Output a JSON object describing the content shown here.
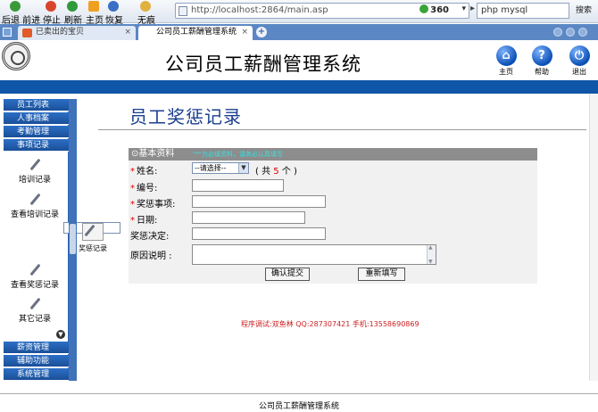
{
  "browser": {
    "nav_buttons": [
      {
        "label": "后退 前进",
        "color": "#3a9a3a"
      },
      {
        "label": "停止",
        "color": "#d9452b"
      },
      {
        "label": "刷新",
        "color": "#2f9a3a"
      },
      {
        "label": "主页",
        "color": "#f0a020"
      },
      {
        "label": "恢复",
        "color": "#3b6fc4"
      },
      {
        "label": "无痕",
        "color": "#e0b040"
      }
    ],
    "url": "http://localhost:2864/main.asp",
    "security_badge": "360",
    "search_query": "php mysql",
    "search_button": "搜索",
    "tabs": [
      {
        "label": "已卖出的宝贝",
        "icon": "taobao-icon"
      },
      {
        "label": "公司员工薪酬管理系统",
        "icon": "page-icon"
      }
    ],
    "tab_close": "×",
    "new_tab": "+"
  },
  "header": {
    "system_title": "公司员工薪酬管理系统",
    "icons": [
      {
        "label": "主页",
        "glyph": "⌂",
        "name": "home-icon"
      },
      {
        "label": "帮助",
        "glyph": "?",
        "name": "help-icon"
      },
      {
        "label": "退出",
        "glyph": "⏻",
        "name": "logout-icon"
      }
    ]
  },
  "sidebar": {
    "top_menus": [
      "员工列表",
      "人事档案",
      "考勤管理",
      "事项记录"
    ],
    "sub_items": [
      "培训记录",
      "查看培训记录",
      "奖惩记录",
      "查看奖惩记录",
      "其它记录"
    ],
    "bottom_menus": [
      "薪资管理",
      "辅助功能",
      "系统管理"
    ]
  },
  "main": {
    "page_title": "员工奖惩记录",
    "section_title": "⊙基本资料",
    "section_note": "\"*\"为必填资料，请务必认真填写",
    "fields": {
      "name_label": "姓名:",
      "name_select_value": "--请选择--",
      "count_prefix": "( 共",
      "count_value": "5",
      "count_suffix": "个 )",
      "id_label": "编号:",
      "item_label": "奖惩事项:",
      "date_label": "日期:",
      "decision_label": "奖惩决定:",
      "reason_label": "原因说明 :"
    },
    "required_mark": "*",
    "submit_button": "确认提交",
    "reset_button": "重新填写",
    "credits": "程序调试:双鱼林 QQ:287307421 手机:13558690869"
  },
  "footer": {
    "text": "公司员工薪酬管理系统"
  }
}
